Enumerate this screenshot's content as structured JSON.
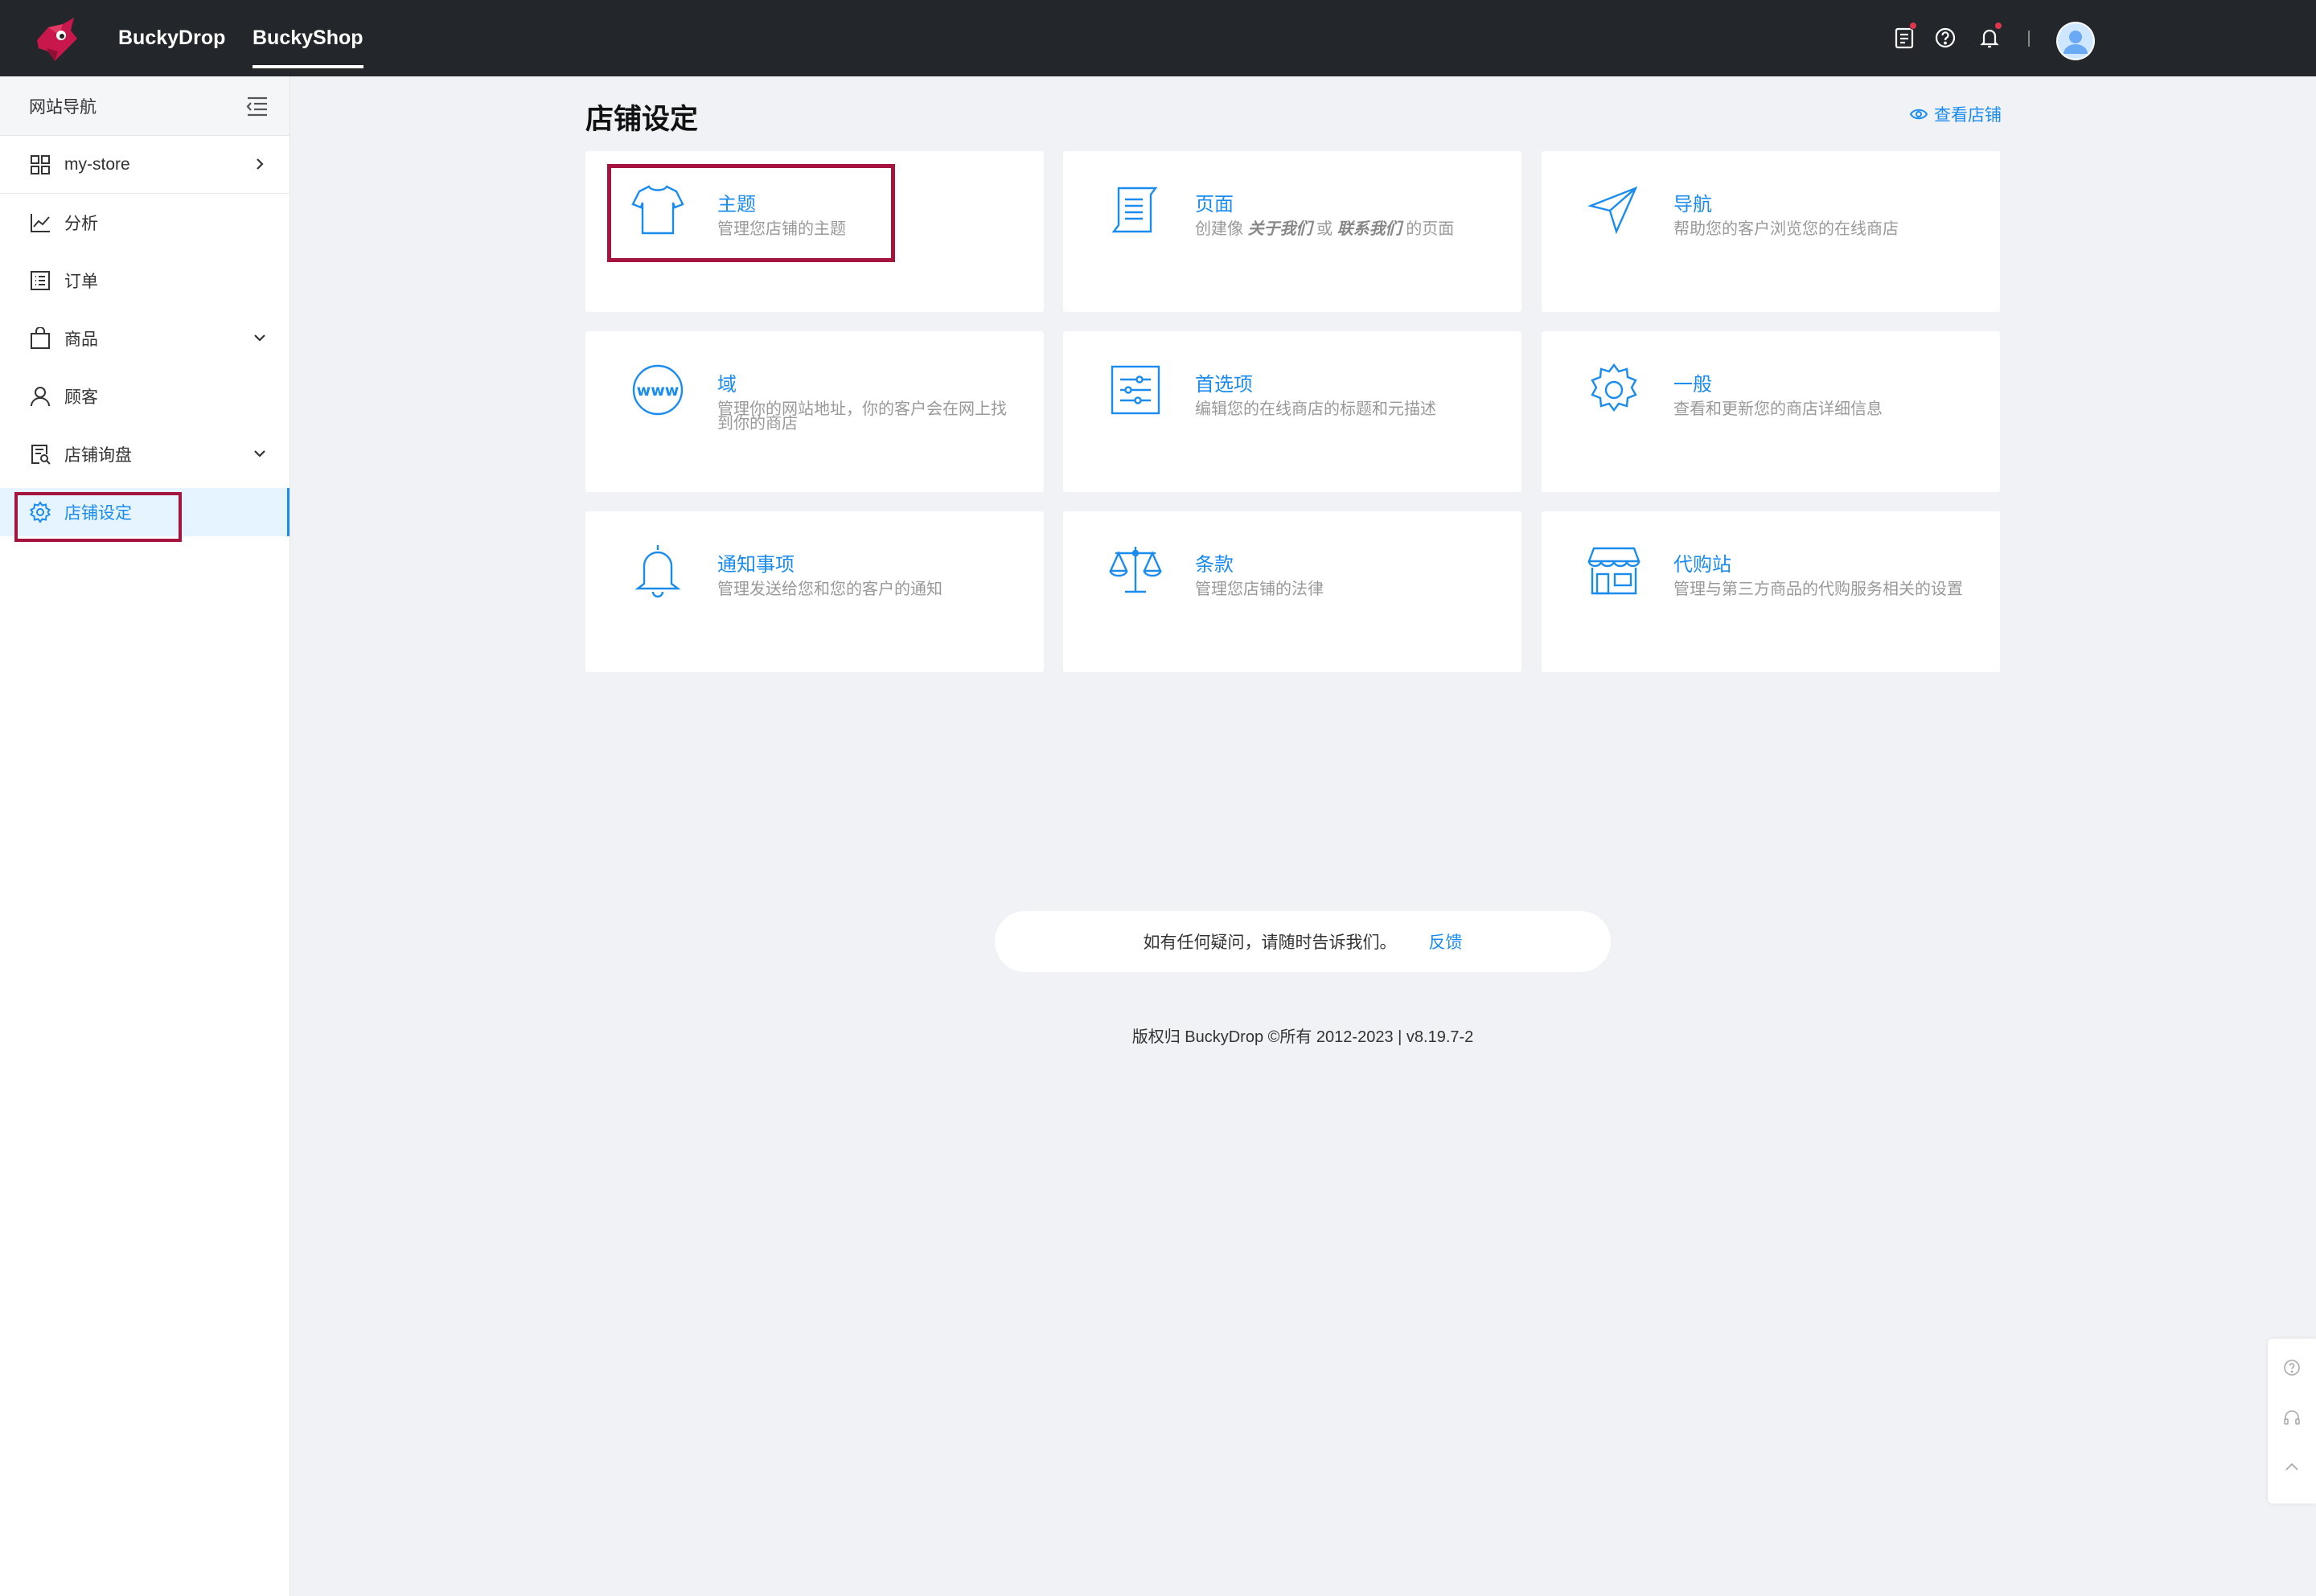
{
  "topbar": {
    "tabs": [
      {
        "label": "BuckyDrop",
        "active": false
      },
      {
        "label": "BuckyShop",
        "active": true
      }
    ],
    "icons": [
      "notes-icon",
      "help-icon",
      "bell-icon"
    ],
    "avatar": "user-avatar"
  },
  "sidebar": {
    "header": "网站导航",
    "items": [
      {
        "label": "my-store",
        "icon": "grid-icon",
        "chevron": "right"
      },
      {
        "label": "分析",
        "icon": "chart-line-icon"
      },
      {
        "label": "订单",
        "icon": "order-list-icon"
      },
      {
        "label": "商品",
        "icon": "bag-icon",
        "chevron": "down"
      },
      {
        "label": "顾客",
        "icon": "user-icon"
      },
      {
        "label": "店铺询盘",
        "icon": "inquiry-icon",
        "chevron": "down"
      },
      {
        "label": "店铺设定",
        "icon": "gear-icon",
        "active": true
      }
    ]
  },
  "main": {
    "title": "店铺设定",
    "view_store": "查看店铺",
    "cards": [
      {
        "title": "主题",
        "desc": "管理您店铺的主题",
        "icon": "tshirt-icon"
      },
      {
        "title": "页面",
        "desc_pre": "创建像 ",
        "desc_b1": "关于我们",
        "desc_mid": " 或 ",
        "desc_b2": "联系我们",
        "desc_post": " 的页面",
        "icon": "page-icon"
      },
      {
        "title": "导航",
        "desc": "帮助您的客户浏览您的在线商店",
        "icon": "navigation-icon"
      },
      {
        "title": "域",
        "desc": "管理你的网站地址，你的客户会在网上找到你的商店",
        "icon": "www-icon"
      },
      {
        "title": "首选项",
        "desc": "编辑您的在线商店的标题和元描述",
        "icon": "preferences-icon"
      },
      {
        "title": "一般",
        "desc": "查看和更新您的商店详细信息",
        "icon": "gear-icon"
      },
      {
        "title": "通知事项",
        "desc": "管理发送给您和您的客户的通知",
        "icon": "bell-icon"
      },
      {
        "title": "条款",
        "desc": "管理您店铺的法律",
        "icon": "scales-icon"
      },
      {
        "title": "代购站",
        "desc": "管理与第三方商品的代购服务相关的设置",
        "icon": "storefront-icon"
      }
    ]
  },
  "footer": {
    "feedback_text": "如有任何疑问，请随时告诉我们。",
    "feedback_link": "反馈",
    "copyright": "版权归 BuckyDrop ©所有 2012-2023 | v8.19.7-2"
  },
  "colors": {
    "accent": "#1a8cf0",
    "topbar": "#23272c",
    "highlight": "#a5143f"
  }
}
